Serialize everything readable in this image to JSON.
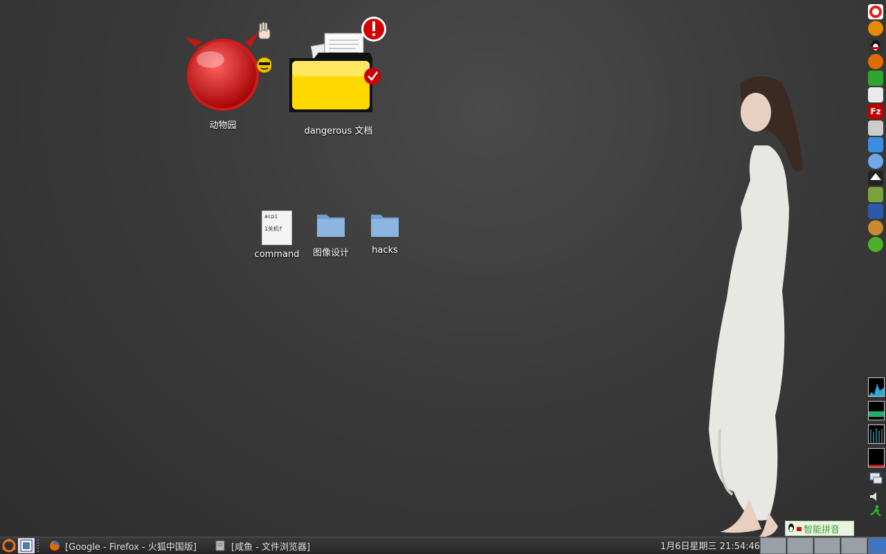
{
  "desktop": {
    "icons": [
      {
        "label": "动物园"
      },
      {
        "label": "dangerous 文档"
      },
      {
        "label": "command",
        "file_text_line1": "acpi",
        "file_text_line2": "1关机f"
      },
      {
        "label": "图像设计"
      },
      {
        "label": "hacks"
      }
    ]
  },
  "dock": {
    "filezilla_letter": "Fz"
  },
  "ime": {
    "label": "智能拼音"
  },
  "taskbar": {
    "windows": [
      {
        "title": "[Google - Firefox - 火狐中国版]"
      },
      {
        "title": "[咸鱼 - 文件浏览器]"
      }
    ],
    "clock": "1月6日星期三 21:54:46"
  },
  "colors": {
    "folder_blue": "#8db5e2",
    "folder_yellow": "#ffd800",
    "devil_red": "#d11a1a",
    "alert_red": "#d40000"
  }
}
